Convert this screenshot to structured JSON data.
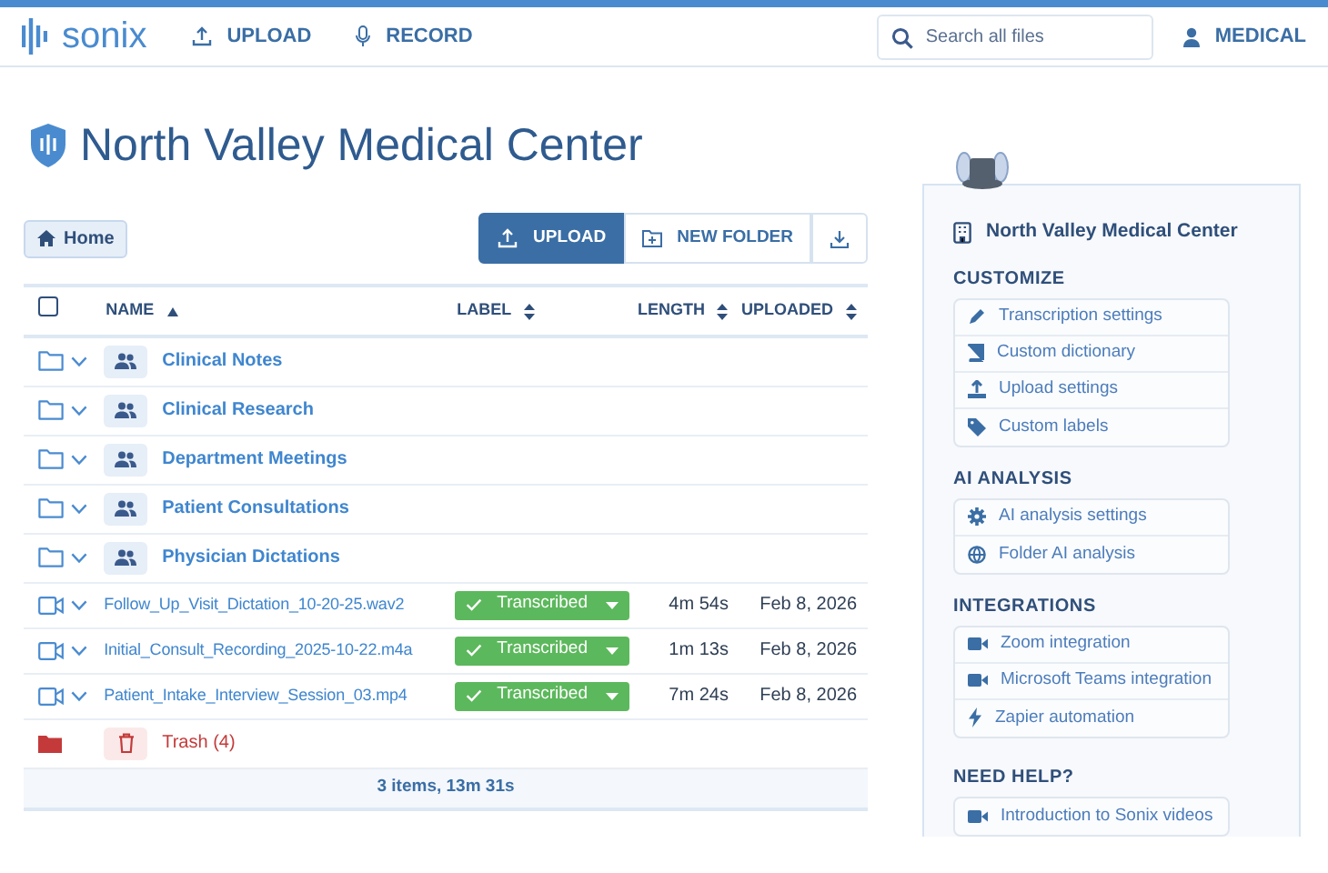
{
  "navbar": {
    "logo": "sonix",
    "links": [
      "UPLOAD",
      "RECORD"
    ],
    "search": {
      "placeholder": "Search all files"
    },
    "account": "MEDICAL"
  },
  "page_title": "North Valley Medical Center",
  "breadcrumb": "Home",
  "toolbar": [
    {
      "label": "UPLOAD",
      "selected": true
    },
    {
      "label": "NEW FOLDER",
      "selected": false
    }
  ],
  "table": {
    "select_all_checked": false,
    "columns": [
      {
        "label": "NAME",
        "sorted": true
      },
      {
        "label": "LABEL",
        "sorted": false
      },
      {
        "label": "LENGTH",
        "sorted": false
      },
      {
        "label": "UPLOADED",
        "sorted": false
      }
    ],
    "rows": [
      {
        "kind": "folder",
        "name": "Clinical Notes"
      },
      {
        "kind": "folder",
        "name": "Clinical Research"
      },
      {
        "kind": "folder",
        "name": "Department Meetings"
      },
      {
        "kind": "folder",
        "name": "Patient Consultations"
      },
      {
        "kind": "folder",
        "name": "Physician Dictations"
      },
      {
        "kind": "file",
        "name": "Follow_Up_Visit_Dictation_10-20-25.wav2",
        "label": "Transcribed",
        "length": "4m 54s",
        "uploaded": "Feb 8, 2026"
      },
      {
        "kind": "file",
        "name": "Initial_Consult_Recording_2025-10-22.m4a",
        "label": "Transcribed",
        "length": "1m 13s",
        "uploaded": "Feb 8, 2026"
      },
      {
        "kind": "file",
        "name": "Patient_Intake_Interview_Session_03.mp4",
        "label": "Transcribed",
        "length": "7m 24s",
        "uploaded": "Feb 8, 2026"
      },
      {
        "kind": "trash",
        "name": "Trash (4)"
      }
    ],
    "footer": "3 items, 13m 31s"
  },
  "sidebar": {
    "title": "North Valley Medical Center",
    "sections": [
      {
        "heading": "CUSTOMIZE",
        "items": [
          "Transcription settings",
          "Custom dictionary",
          "Upload settings",
          "Custom labels"
        ]
      },
      {
        "heading": "AI ANALYSIS",
        "items": [
          "AI analysis settings",
          "Folder AI analysis"
        ]
      },
      {
        "heading": "INTEGRATIONS",
        "items": [
          "Zoom integration",
          "Microsoft Teams integration",
          "Zapier automation"
        ]
      },
      {
        "heading": "NEED HELP?",
        "items": [
          "Introduction to Sonix videos"
        ]
      }
    ]
  }
}
